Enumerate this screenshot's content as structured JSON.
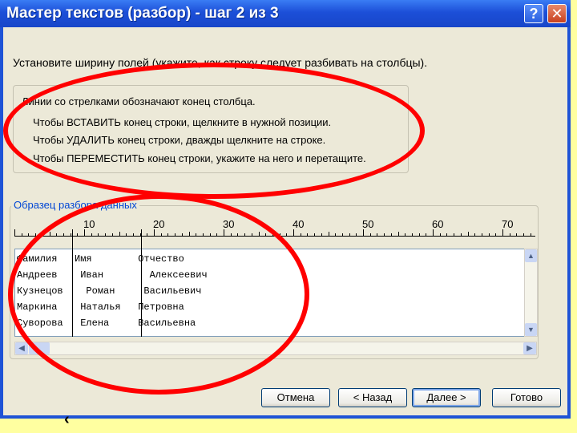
{
  "window": {
    "title": "Мастер текстов (разбор) - шаг 2 из 3",
    "help_glyph": "?",
    "close_glyph": "✕"
  },
  "instruction": "Установите ширину полей (укажите, как строку следует разбивать на столбцы).",
  "info": {
    "line1": "Линии со стрелками обозначают конец столбца.",
    "line2": "Чтобы ВСТАВИТЬ конец строки, щелкните в нужной позиции.",
    "line3": "Чтобы УДАЛИТЬ конец строки, дважды щелкните на строке.",
    "line4": "Чтобы ПЕРЕМЕСТИТЬ конец строки, укажите на него и перетащите."
  },
  "preview_group_title": "Образец разбора данных",
  "ruler_labels": [
    "10",
    "20",
    "30",
    "40",
    "50",
    "60",
    "70"
  ],
  "preview_rows": [
    "Фамилия   Имя        Отчество",
    "Андреев    Иван        Алексеевич",
    "Кузнецов    Роман     Васильевич",
    "Маркина    Наталья   Петровна",
    "Суворова   Елена     Васильевна"
  ],
  "buttons": {
    "cancel": "Отмена",
    "back": "< Назад",
    "next": "Далее >",
    "finish": "Готово"
  },
  "icons": {
    "scroll_up": "up-arrow-icon",
    "scroll_down": "down-arrow-icon",
    "scroll_left": "left-arrow-icon",
    "scroll_right": "right-arrow-icon"
  },
  "colors": {
    "title_bar": "#1c4fd8",
    "dialog_face": "#ece9d8",
    "annotation": "#ff0000",
    "background": "#ffffa0",
    "group_title": "#0046d5"
  }
}
